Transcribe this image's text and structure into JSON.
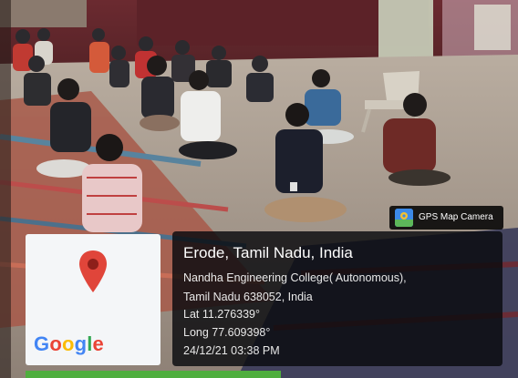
{
  "badge": {
    "label": "GPS Map Camera",
    "icon": "gps-map-camera-icon",
    "color": "#3c8ae8"
  },
  "map_thumbnail": {
    "icon": "map-pin-icon",
    "pin_color": "#e0453a",
    "logo_letters": [
      {
        "char": "G",
        "color": "#4285f4"
      },
      {
        "char": "o",
        "color": "#ea4335"
      },
      {
        "char": "o",
        "color": "#fbbc05"
      },
      {
        "char": "g",
        "color": "#4285f4"
      },
      {
        "char": "l",
        "color": "#34a853"
      },
      {
        "char": "e",
        "color": "#ea4335"
      }
    ]
  },
  "location": {
    "city": "Erode, Tamil Nadu, India",
    "address_line1": "Nandha Engineering College( Autonomous),",
    "address_line2": "Tamil Nadu 638052, India",
    "latitude": "Lat 11.276339°",
    "longitude": "Long 77.609398°",
    "timestamp": "24/12/21 03:38 PM"
  }
}
